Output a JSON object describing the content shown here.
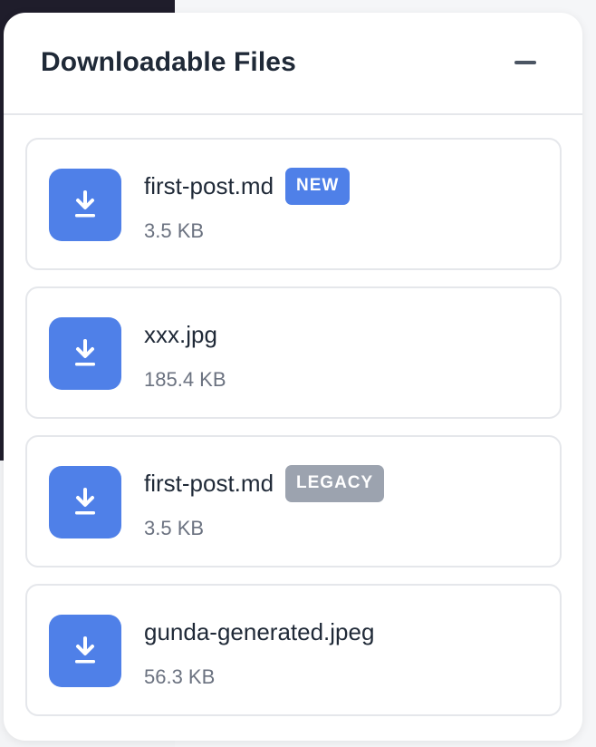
{
  "panel": {
    "title": "Downloadable Files",
    "collapse_icon": "minus-icon"
  },
  "files": [
    {
      "name": "first-post.md",
      "size": "3.5 KB",
      "badge": "NEW",
      "badge_color": "#4f80e8",
      "icon": "download-icon"
    },
    {
      "name": "xxx.jpg",
      "size": "185.4 KB",
      "badge": null,
      "icon": "download-icon"
    },
    {
      "name": "first-post.md",
      "size": "3.5 KB",
      "badge": "LEGACY",
      "badge_color": "#9ca3af",
      "icon": "download-icon"
    },
    {
      "name": "gunda-generated.jpeg",
      "size": "56.3 KB",
      "badge": null,
      "icon": "download-icon"
    }
  ],
  "colors": {
    "accent": "#4f80e8",
    "legacy_badge": "#9ca3af",
    "text_primary": "#1f2937",
    "text_secondary": "#6b7280",
    "border": "#e5e7eb"
  }
}
